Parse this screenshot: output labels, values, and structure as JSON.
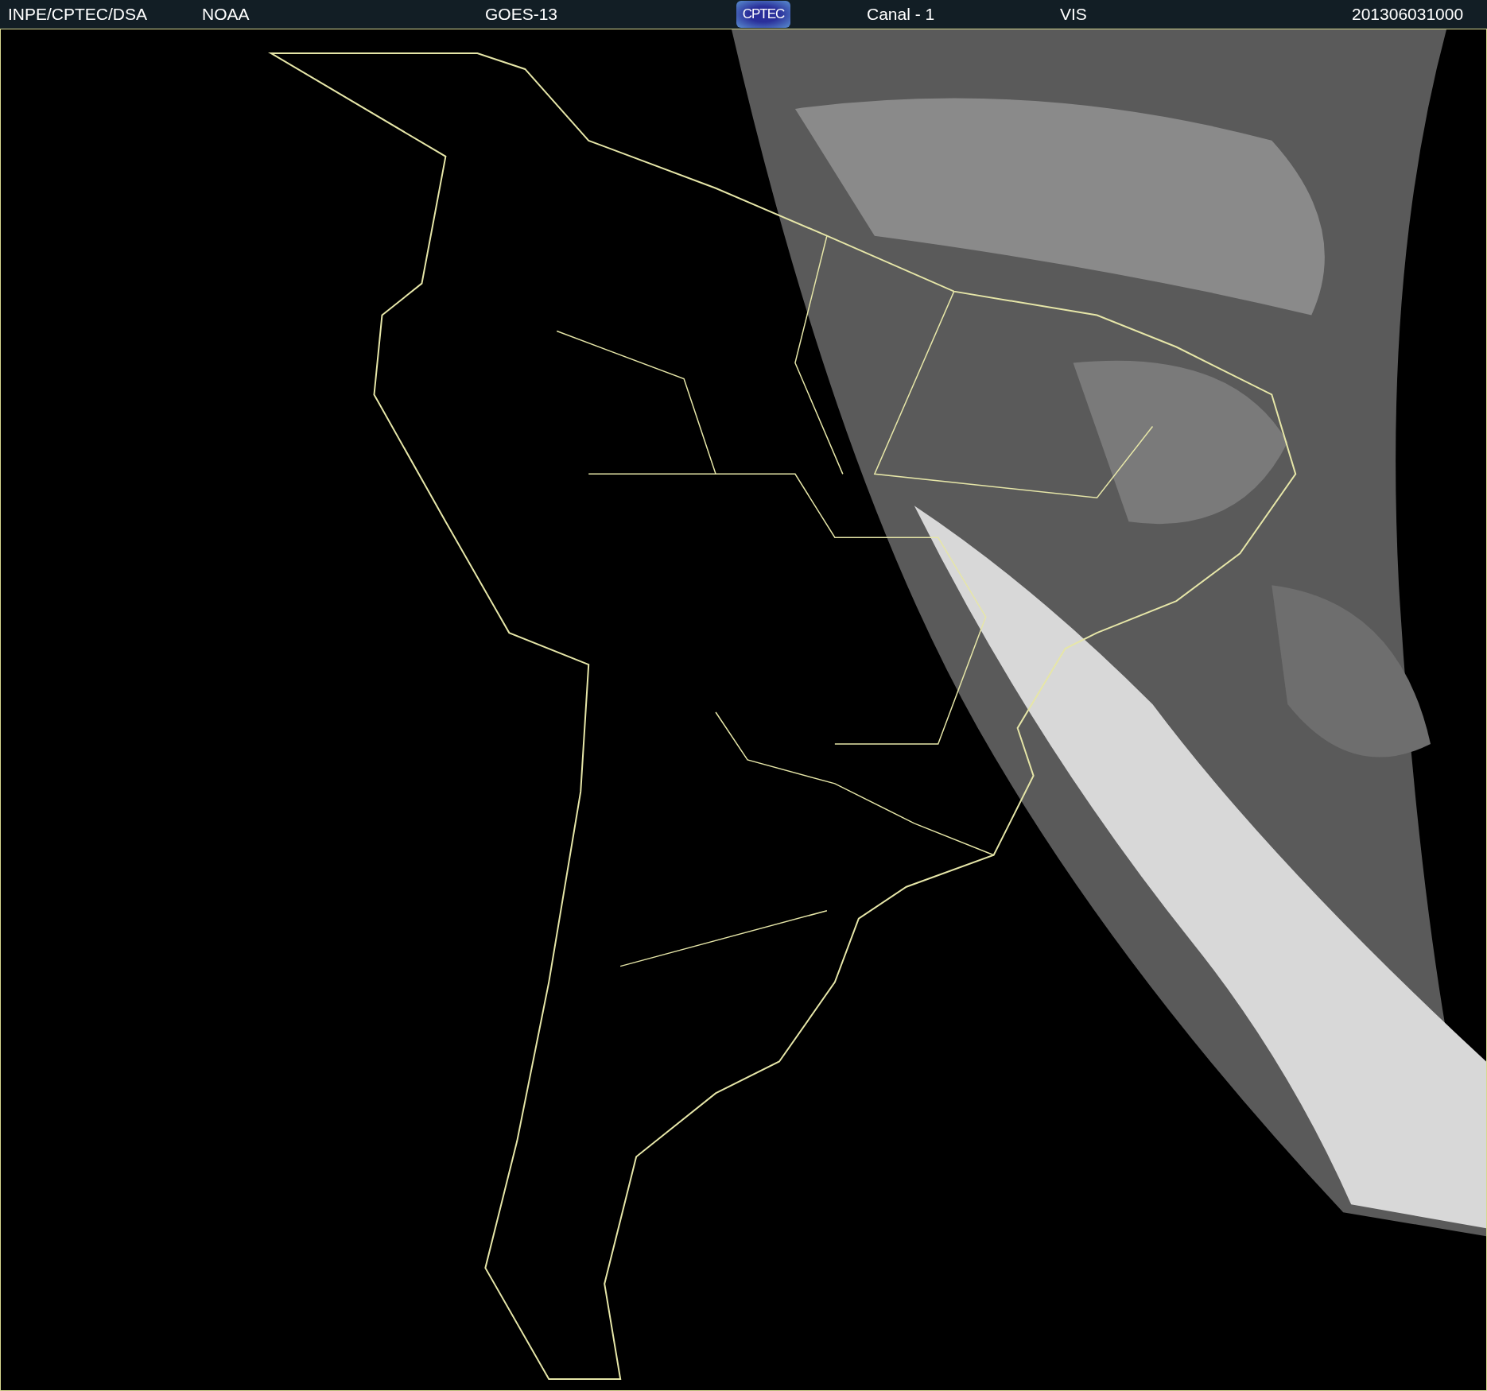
{
  "header": {
    "items": [
      {
        "kind": "text",
        "text": "INPE/CPTEC/DSA"
      },
      {
        "kind": "text",
        "text": "NOAA"
      },
      {
        "kind": "text",
        "text": "GOES-13"
      },
      {
        "kind": "logo",
        "text": "CPTEC"
      },
      {
        "kind": "text",
        "text": "Canal - 1"
      },
      {
        "kind": "text",
        "text": "VIS"
      },
      {
        "kind": "text",
        "text": "201306031000"
      }
    ]
  }
}
